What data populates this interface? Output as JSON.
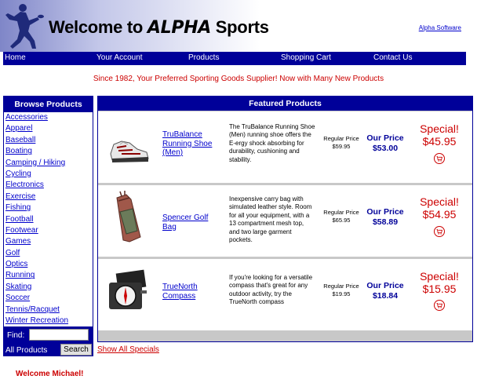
{
  "header": {
    "title_prefix": "Welcome to ",
    "brand": "ALPHA",
    "title_suffix": " Sports",
    "alpha_software": "Alpha Software"
  },
  "nav": [
    "Home",
    "Your Account",
    "Products",
    "Shopping Cart",
    "Contact Us"
  ],
  "tagline": "Since 1982, Your Preferred Sporting Goods Supplier! Now with Many New Products",
  "sidebar": {
    "heading": "Browse Products",
    "categories": [
      "Accessories",
      "Apparel",
      "Baseball",
      "Boating",
      "Camping / Hiking",
      "Cycling",
      "Electronics",
      "Exercise",
      "Fishing",
      "Football",
      "Footwear",
      "Games",
      "Golf",
      "Optics",
      "Running",
      "Skating",
      "Soccer",
      "Tennis/Racquet",
      "Winter Recreation"
    ],
    "find_label": "Find:",
    "find_value": "",
    "all_products": "All Products",
    "search_button": "Search"
  },
  "featured": {
    "heading": "Featured Products",
    "products": [
      {
        "name": "TruBalance Running Shoe (Men)",
        "description": "The TruBalance Running Shoe (Men) running shoe offers the E-ergy shock absorbing for durability, cushioning and stability.",
        "regular_label": "Regular Price",
        "regular_price": "$59.95",
        "our_label": "Our Price",
        "our_price": "$53.00",
        "special_label": "Special!",
        "special_price": "$45.95",
        "image_icon": "running-shoe-image"
      },
      {
        "name": "Spencer Golf Bag",
        "description": "Inexpensive carry bag with simulated leather style. Room for all your equipment, with a 13 compartment mesh top, and two large garment pockets.",
        "regular_label": "Regular Price",
        "regular_price": "$65.95",
        "our_label": "Our Price",
        "our_price": "$58.89",
        "special_label": "Special!",
        "special_price": "$54.95",
        "image_icon": "golf-bag-image"
      },
      {
        "name": "TrueNorth Compass",
        "description": "If you're looking for a versatile compass that's great for any outdoor activity, try the TrueNorth compass",
        "regular_label": "Regular Price",
        "regular_price": "$19.95",
        "our_label": "Our Price",
        "our_price": "$18.84",
        "special_label": "Special!",
        "special_price": "$15.95",
        "image_icon": "compass-image"
      }
    ]
  },
  "show_all_specials": "Show All Specials",
  "welcome": "Welcome Michael!",
  "colors": {
    "nav_bg": "#000099",
    "accent_red": "#cc0000",
    "link": "#0000cc"
  }
}
